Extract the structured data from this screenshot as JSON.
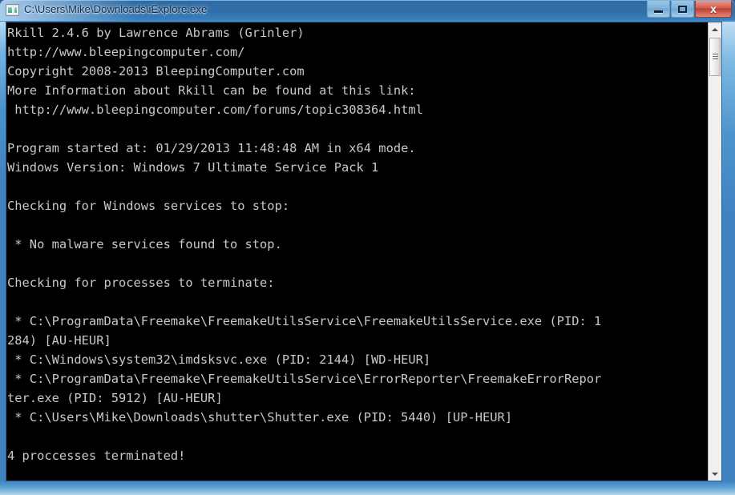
{
  "window": {
    "title": "C:\\Users\\Mike\\Downloads\\iExplore.exe",
    "icon": "console-window-icon",
    "caption": {
      "minimize_label": "Minimize",
      "maximize_label": "Maximize",
      "close_label": "x"
    },
    "frame_color": "#3f83c0",
    "titlebar_color": "#2d6ca8"
  },
  "console": {
    "background_color": "#000000",
    "text_color": "#c8c8c8",
    "lines": [
      "Rkill 2.4.6 by Lawrence Abrams (Grinler)",
      "http://www.bleepingcomputer.com/",
      "Copyright 2008-2013 BleepingComputer.com",
      "More Information about Rkill can be found at this link:",
      " http://www.bleepingcomputer.com/forums/topic308364.html",
      "",
      "Program started at: 01/29/2013 11:48:48 AM in x64 mode.",
      "Windows Version: Windows 7 Ultimate Service Pack 1",
      "",
      "Checking for Windows services to stop:",
      "",
      " * No malware services found to stop.",
      "",
      "Checking for processes to terminate:",
      "",
      " * C:\\ProgramData\\Freemake\\FreemakeUtilsService\\FreemakeUtilsService.exe (PID: 1",
      "284) [AU-HEUR]",
      " * C:\\Windows\\system32\\imdsksvc.exe (PID: 2144) [WD-HEUR]",
      " * C:\\ProgramData\\Freemake\\FreemakeUtilsService\\ErrorReporter\\FreemakeErrorRepor",
      "ter.exe (PID: 5912) [AU-HEUR]",
      " * C:\\Users\\Mike\\Downloads\\shutter\\Shutter.exe (PID: 5440) [UP-HEUR]",
      "",
      "4 proccesses terminated!"
    ]
  },
  "scrollbar": {
    "up_arrow": "scroll-up-arrow",
    "down_arrow": "scroll-down-arrow",
    "thumb": "scroll-thumb"
  }
}
